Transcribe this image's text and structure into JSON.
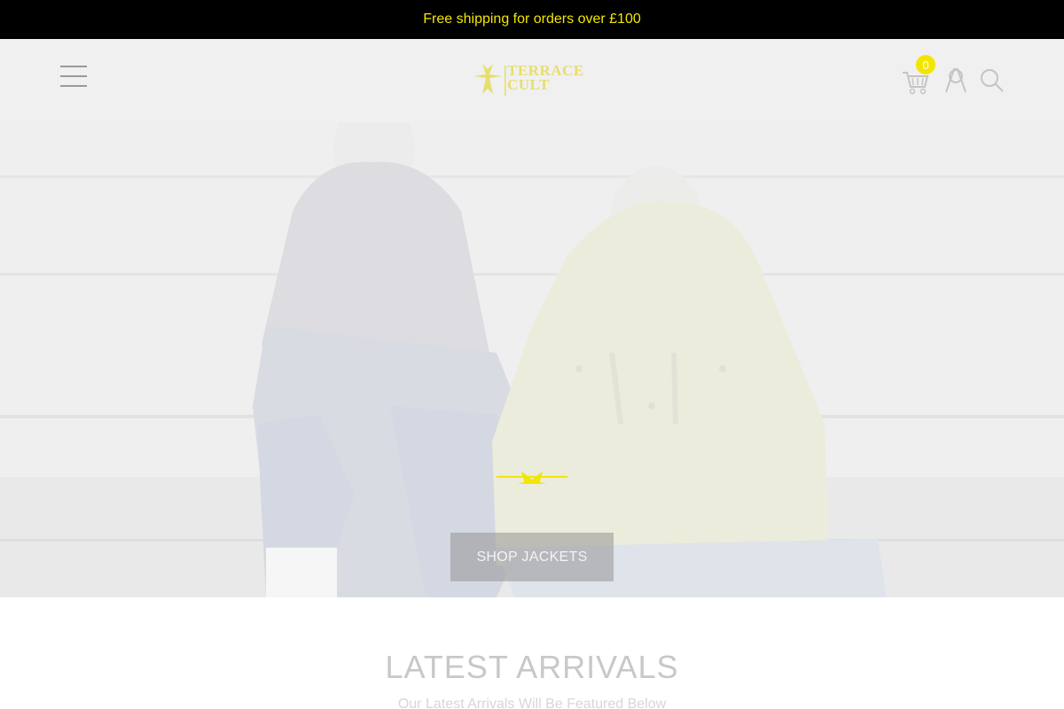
{
  "announcement": {
    "text": "Free shipping for orders over £100"
  },
  "header": {
    "logo_text_line1": "TERRACE",
    "logo_text_line2": "CULT",
    "cart_count": "0"
  },
  "hero": {
    "button_label": "SHOP JACKETS"
  },
  "latest": {
    "title": "LATEST ARRIVALS",
    "subtitle": "Our Latest Arrivals Will Be Featured Below"
  },
  "colors": {
    "accent": "#f2e600",
    "topbar_bg": "#000000",
    "header_bg": "#f0f0f0"
  },
  "icons": [
    "hamburger-menu-icon",
    "cart-icon",
    "account-icon",
    "search-icon",
    "loading-spinner-icon"
  ]
}
